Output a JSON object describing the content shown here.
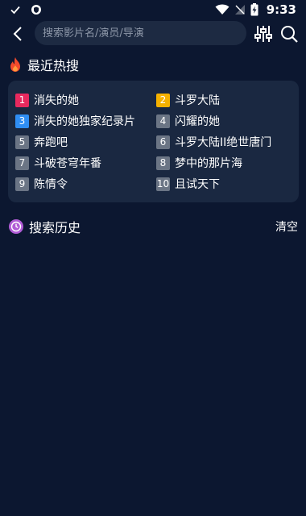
{
  "status": {
    "time": "9:33",
    "icons": [
      "check-icon",
      "shield-icon",
      "wifi-icon",
      "signal-off-icon",
      "battery-charging-icon"
    ]
  },
  "search": {
    "placeholder": "搜索影片名/演员/导演",
    "value": ""
  },
  "hot": {
    "title": "最近热搜",
    "colors": {
      "rank1": "#e8295e",
      "rank2": "#f5b100",
      "rank3": "#2f8ef4",
      "rank_other": "#6b7585"
    },
    "items": [
      {
        "rank": "1",
        "name": "消失的她"
      },
      {
        "rank": "2",
        "name": "斗罗大陆"
      },
      {
        "rank": "3",
        "name": "消失的她独家纪录片"
      },
      {
        "rank": "4",
        "name": "闪耀的她"
      },
      {
        "rank": "5",
        "name": "奔跑吧"
      },
      {
        "rank": "6",
        "name": "斗罗大陆II绝世唐门"
      },
      {
        "rank": "7",
        "name": "斗破苍穹年番"
      },
      {
        "rank": "8",
        "name": "梦中的那片海"
      },
      {
        "rank": "9",
        "name": "陈情令"
      },
      {
        "rank": "10",
        "name": "且试天下"
      }
    ]
  },
  "history": {
    "title": "搜索历史",
    "clear_label": "清空"
  }
}
